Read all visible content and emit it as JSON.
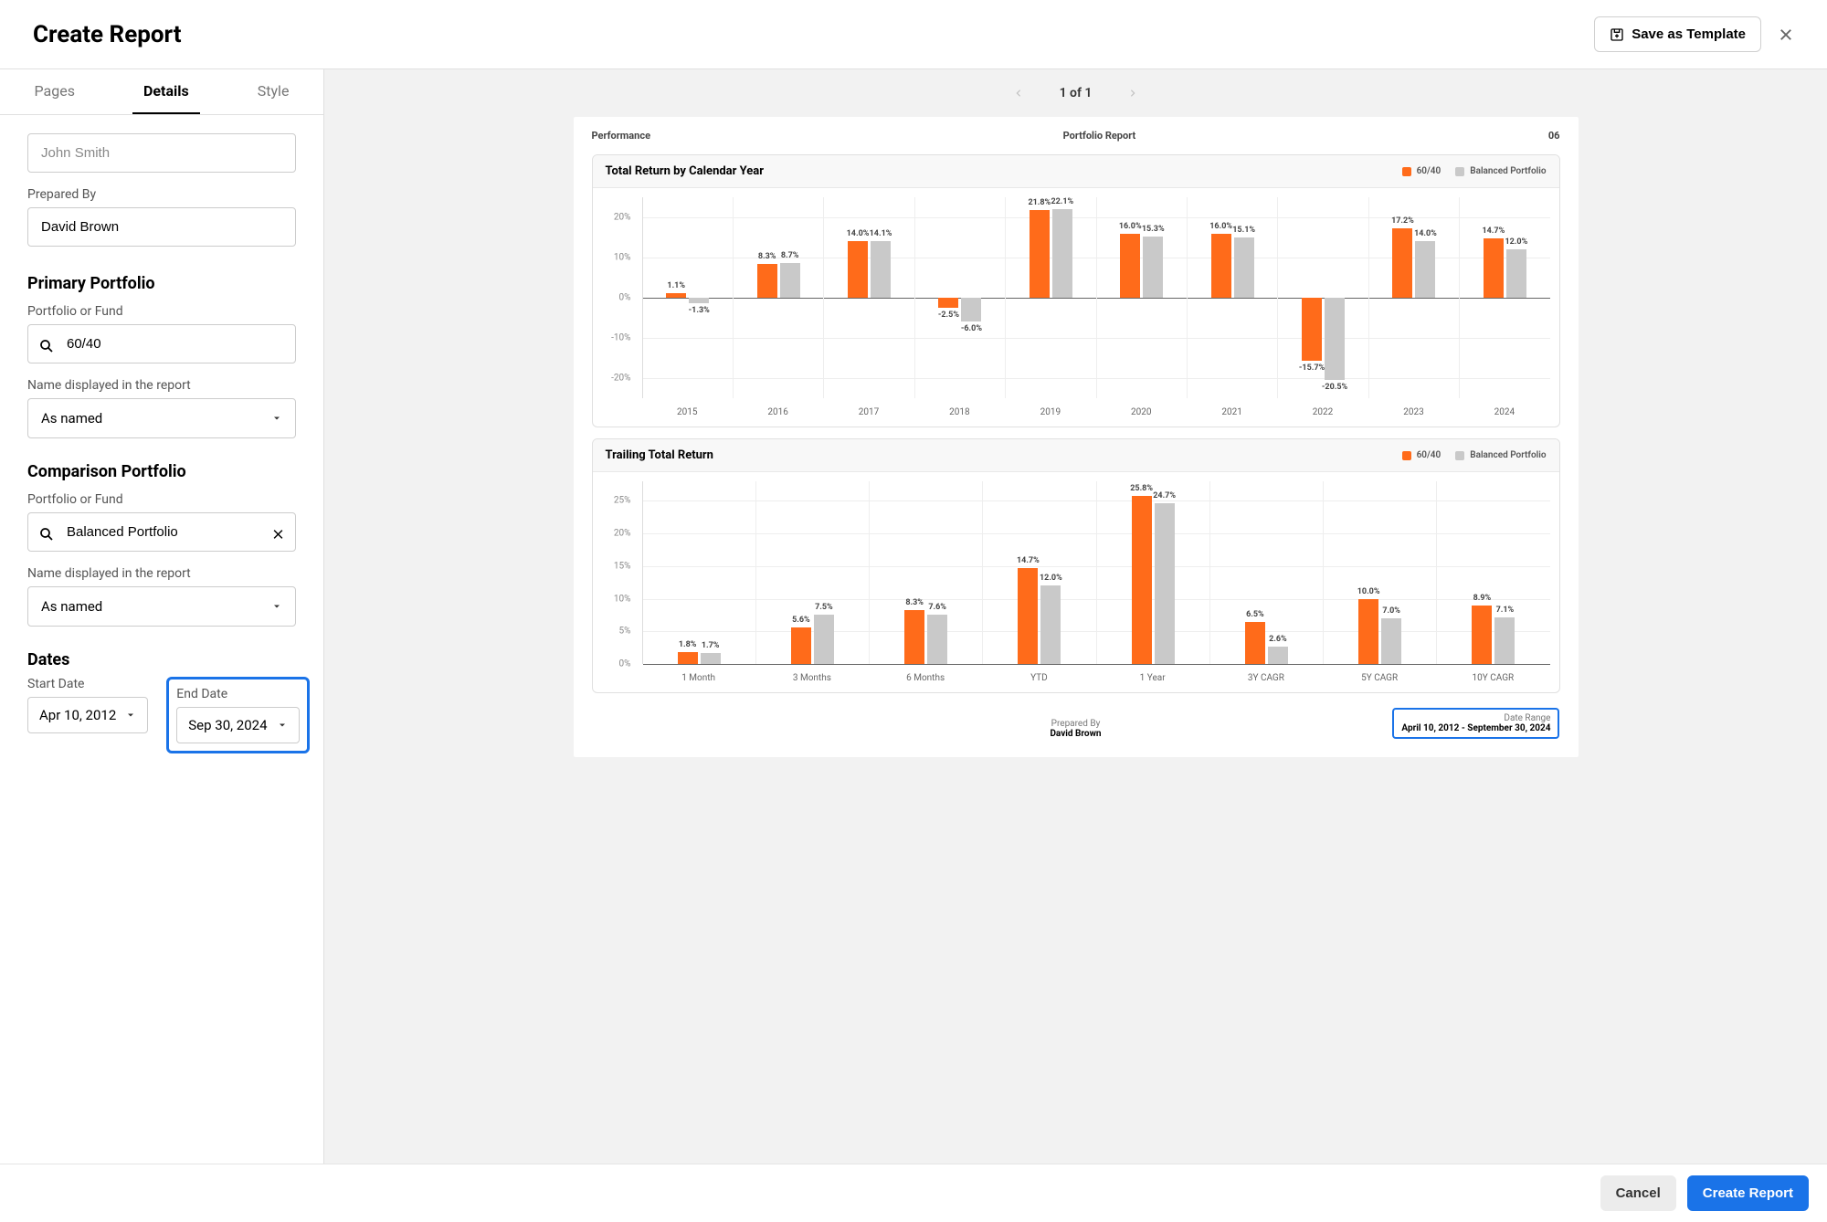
{
  "header": {
    "title": "Create Report",
    "save_template": "Save as Template"
  },
  "sidebar": {
    "tabs": {
      "pages": "Pages",
      "details": "Details",
      "style": "Style"
    },
    "client_name": "John Smith",
    "prepared_by_label": "Prepared By",
    "prepared_by_value": "David Brown",
    "primary_heading": "Primary Portfolio",
    "portfolio_label": "Portfolio or Fund",
    "primary_portfolio_value": "60/40",
    "name_display_label": "Name displayed in the report",
    "name_display_value": "As named",
    "comparison_heading": "Comparison Portfolio",
    "comparison_portfolio_value": "Balanced Portfolio",
    "dates_heading": "Dates",
    "start_date_label": "Start Date",
    "start_date_value": "Apr 10, 2012",
    "end_date_label": "End Date",
    "end_date_value": "Sep 30, 2024"
  },
  "paginator": {
    "text": "1 of 1"
  },
  "page": {
    "left": "Performance",
    "center": "Portfolio Report",
    "right": "06",
    "foot_prepared_label": "Prepared By",
    "foot_prepared_value": "David Brown",
    "foot_range_label": "Date Range",
    "foot_range_value": "April 10, 2012 - September 30, 2024"
  },
  "chart_data": [
    {
      "type": "bar",
      "title": "Total Return by Calendar Year",
      "ylim": [
        -25,
        25
      ],
      "yticks": [
        "20%",
        "10%",
        "0%",
        "-10%",
        "-20%"
      ],
      "categories": [
        "2015",
        "2016",
        "2017",
        "2018",
        "2019",
        "2020",
        "2021",
        "2022",
        "2023",
        "2024"
      ],
      "series": [
        {
          "name": "60/40",
          "color": "#ff6b1a",
          "values": [
            1.1,
            8.3,
            14.0,
            -2.5,
            21.8,
            16.0,
            16.0,
            -15.7,
            17.2,
            14.7
          ]
        },
        {
          "name": "Balanced Portfolio",
          "color": "#c9c9c9",
          "values": [
            -1.3,
            8.7,
            14.1,
            -6.0,
            22.1,
            15.3,
            15.1,
            -20.5,
            14.0,
            12.0
          ]
        }
      ]
    },
    {
      "type": "bar",
      "title": "Trailing Total Return",
      "ylim": [
        0,
        28
      ],
      "yticks": [
        "25%",
        "20%",
        "15%",
        "10%",
        "5%",
        "0%"
      ],
      "categories": [
        "1 Month",
        "3 Months",
        "6 Months",
        "YTD",
        "1 Year",
        "3Y CAGR",
        "5Y CAGR",
        "10Y CAGR"
      ],
      "series": [
        {
          "name": "60/40",
          "color": "#ff6b1a",
          "values": [
            1.8,
            5.6,
            8.3,
            14.7,
            25.8,
            6.5,
            10.0,
            8.9
          ]
        },
        {
          "name": "Balanced Portfolio",
          "color": "#c9c9c9",
          "values": [
            1.7,
            7.5,
            7.6,
            12.0,
            24.7,
            2.6,
            7.0,
            7.1
          ]
        }
      ]
    }
  ],
  "footer": {
    "cancel": "Cancel",
    "create": "Create Report"
  }
}
